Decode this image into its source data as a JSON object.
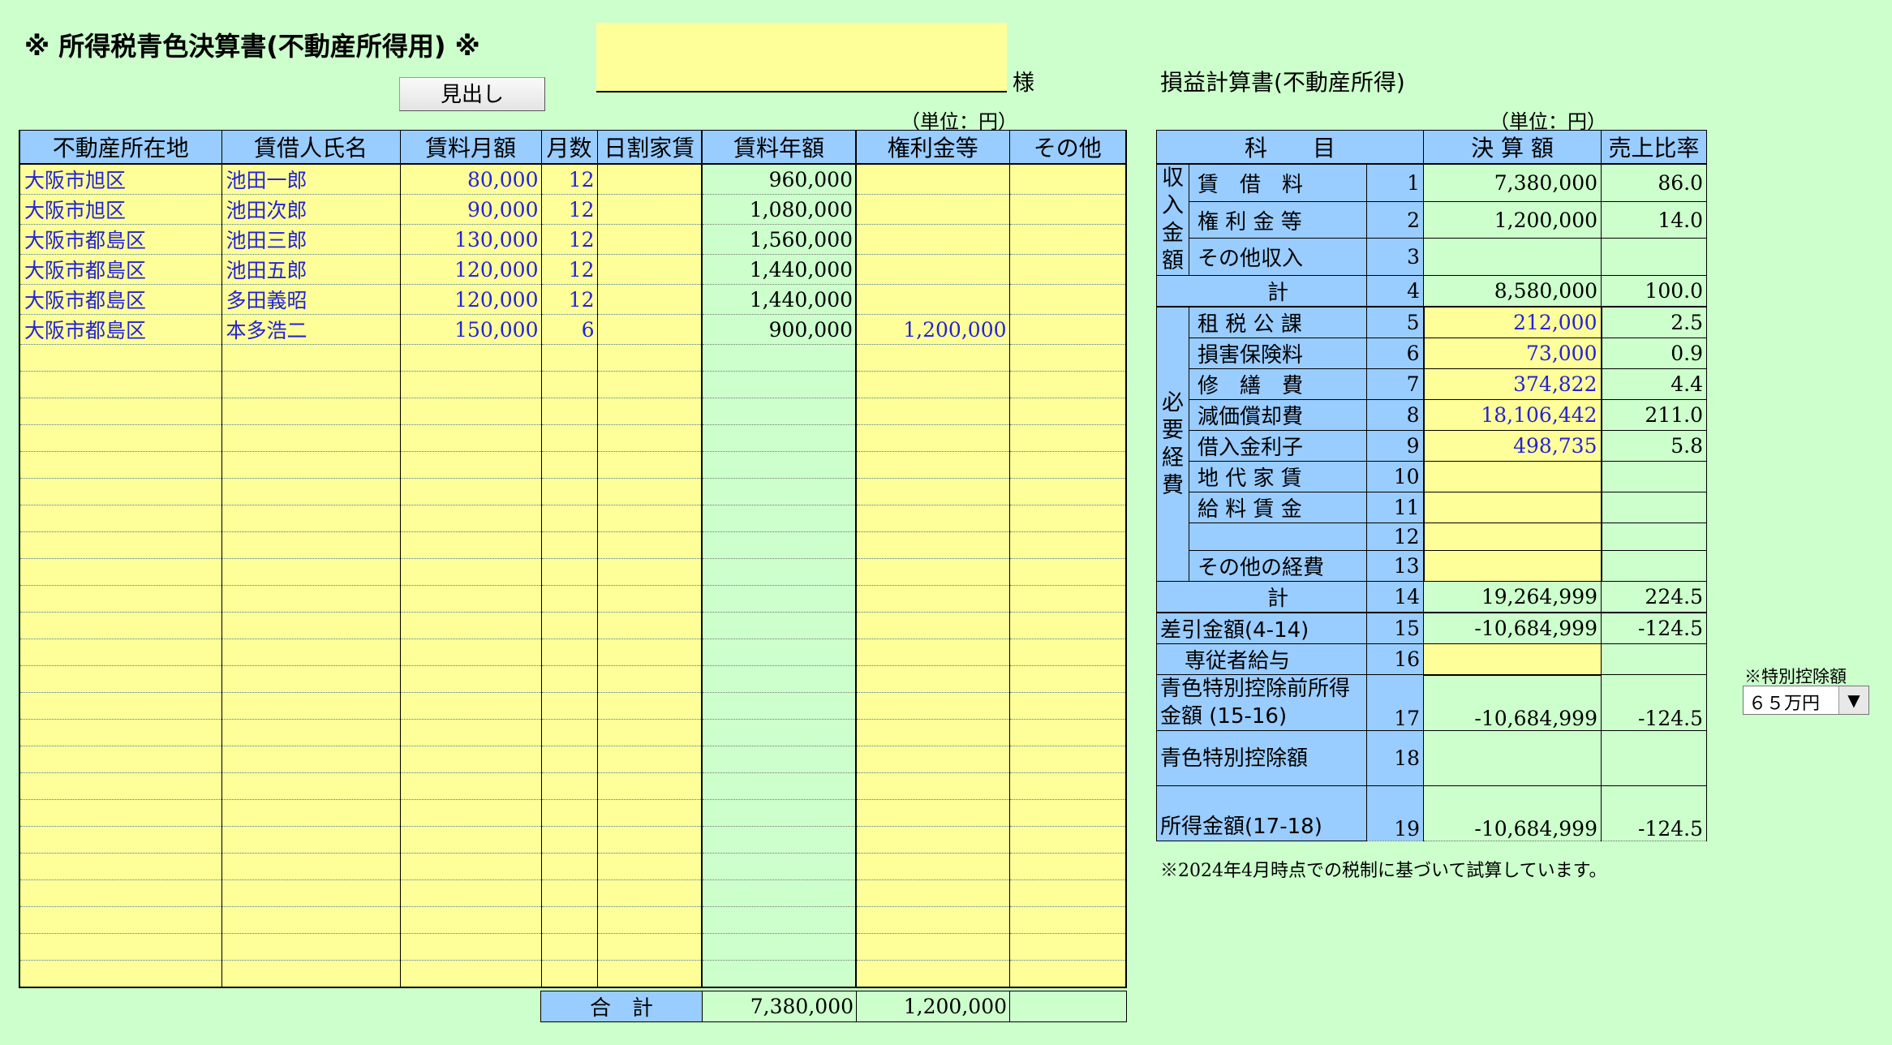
{
  "header": {
    "title": "※ 所得税青色決算書(不動産所得用) ※",
    "name_value": "",
    "honorific": "様",
    "heading_button": "見出し"
  },
  "rental_table": {
    "unit": "（単位：円）",
    "columns": [
      "不動産所在地",
      "賃借人氏名",
      "賃料月額",
      "月数",
      "日割家賃",
      "賃料年額",
      "権利金等",
      "その他"
    ],
    "rows": [
      [
        "大阪市旭区",
        "池田一郎",
        "80,000",
        "12",
        "",
        "960,000",
        "",
        ""
      ],
      [
        "大阪市旭区",
        "池田次郎",
        "90,000",
        "12",
        "",
        "1,080,000",
        "",
        ""
      ],
      [
        "大阪市都島区",
        "池田三郎",
        "130,000",
        "12",
        "",
        "1,560,000",
        "",
        ""
      ],
      [
        "大阪市都島区",
        "池田五郎",
        "120,000",
        "12",
        "",
        "1,440,000",
        "",
        ""
      ],
      [
        "大阪市都島区",
        "多田義昭",
        "120,000",
        "12",
        "",
        "1,440,000",
        "",
        ""
      ],
      [
        "大阪市都島区",
        "本多浩二",
        "150,000",
        "6",
        "",
        "900,000",
        "1,200,000",
        ""
      ],
      [
        "",
        "",
        "",
        "",
        "",
        "",
        "",
        ""
      ],
      [
        "",
        "",
        "",
        "",
        "",
        "",
        "",
        ""
      ],
      [
        "",
        "",
        "",
        "",
        "",
        "",
        "",
        ""
      ],
      [
        "",
        "",
        "",
        "",
        "",
        "",
        "",
        ""
      ],
      [
        "",
        "",
        "",
        "",
        "",
        "",
        "",
        ""
      ],
      [
        "",
        "",
        "",
        "",
        "",
        "",
        "",
        ""
      ],
      [
        "",
        "",
        "",
        "",
        "",
        "",
        "",
        ""
      ],
      [
        "",
        "",
        "",
        "",
        "",
        "",
        "",
        ""
      ],
      [
        "",
        "",
        "",
        "",
        "",
        "",
        "",
        ""
      ],
      [
        "",
        "",
        "",
        "",
        "",
        "",
        "",
        ""
      ],
      [
        "",
        "",
        "",
        "",
        "",
        "",
        "",
        ""
      ],
      [
        "",
        "",
        "",
        "",
        "",
        "",
        "",
        ""
      ],
      [
        "",
        "",
        "",
        "",
        "",
        "",
        "",
        ""
      ],
      [
        "",
        "",
        "",
        "",
        "",
        "",
        "",
        ""
      ],
      [
        "",
        "",
        "",
        "",
        "",
        "",
        "",
        ""
      ],
      [
        "",
        "",
        "",
        "",
        "",
        "",
        "",
        ""
      ],
      [
        "",
        "",
        "",
        "",
        "",
        "",
        "",
        ""
      ],
      [
        "",
        "",
        "",
        "",
        "",
        "",
        "",
        ""
      ],
      [
        "",
        "",
        "",
        "",
        "",
        "",
        "",
        ""
      ],
      [
        "",
        "",
        "",
        "",
        "",
        "",
        "",
        ""
      ],
      [
        "",
        "",
        "",
        "",
        "",
        "",
        "",
        ""
      ],
      [
        "",
        "",
        "",
        "",
        "",
        "",
        "",
        ""
      ],
      [
        "",
        "",
        "",
        "",
        "",
        "",
        "",
        ""
      ],
      [
        "",
        "",
        "",
        "",
        "",
        "",
        "",
        ""
      ]
    ],
    "total_label": "合　計",
    "total_annual": "7,380,000",
    "total_key_money": "1,200,000",
    "total_other": ""
  },
  "pl": {
    "title": "損益計算書(不動産所得)",
    "unit": "（単位：円）",
    "headers": [
      "科　　目",
      "決 算 額",
      "売上比率"
    ],
    "income_category": "収入金額",
    "income": [
      {
        "label": "賃　借　料",
        "no": "1",
        "amount": "7,380,000",
        "ratio": "86.0"
      },
      {
        "label": "権 利 金 等",
        "no": "2",
        "amount": "1,200,000",
        "ratio": "14.0"
      },
      {
        "label": "その他収入",
        "no": "3",
        "amount": "",
        "ratio": ""
      },
      {
        "label": "計",
        "no": "4",
        "amount": "8,580,000",
        "ratio": "100.0"
      }
    ],
    "expense_category": "必要経費",
    "expenses": [
      {
        "label": "租 税 公 課",
        "no": "5",
        "amount": "212,000",
        "ratio": "2.5"
      },
      {
        "label": "損害保険料",
        "no": "6",
        "amount": "73,000",
        "ratio": "0.9"
      },
      {
        "label": "修　繕　費",
        "no": "7",
        "amount": "374,822",
        "ratio": "4.4"
      },
      {
        "label": "減価償却費",
        "no": "8",
        "amount": "18,106,442",
        "ratio": "211.0"
      },
      {
        "label": "借入金利子",
        "no": "9",
        "amount": "498,735",
        "ratio": "5.8"
      },
      {
        "label": "地 代 家 賃",
        "no": "10",
        "amount": "",
        "ratio": ""
      },
      {
        "label": "給 料 賃 金",
        "no": "11",
        "amount": "",
        "ratio": ""
      },
      {
        "label": "",
        "no": "12",
        "amount": "",
        "ratio": ""
      },
      {
        "label": "その他の経費",
        "no": "13",
        "amount": "",
        "ratio": ""
      },
      {
        "label": "計",
        "no": "14",
        "amount": "19,264,999",
        "ratio": "224.5"
      }
    ],
    "diff": {
      "label": "差引金額(4-14)",
      "no": "15",
      "amount": "-10,684,999",
      "ratio": "-124.5"
    },
    "family_salary": {
      "label": "専従者給与",
      "no": "16",
      "amount": "",
      "ratio": ""
    },
    "pre_deduction": {
      "label": "青色特別控除前所得金額 (15-16)",
      "no": "17",
      "amount": "-10,684,999",
      "ratio": "-124.5"
    },
    "deduction": {
      "label": "青色特別控除額",
      "no": "18",
      "amount": "",
      "ratio": ""
    },
    "income_amount": {
      "label": "所得金額(17-18)",
      "no": "19",
      "amount": "-10,684,999",
      "ratio": "-124.5"
    }
  },
  "special_deduction": {
    "label": "※特別控除額",
    "selected": "６５万円"
  },
  "footnote": "※2024年4月時点での税制に基づいて試算しています。"
}
